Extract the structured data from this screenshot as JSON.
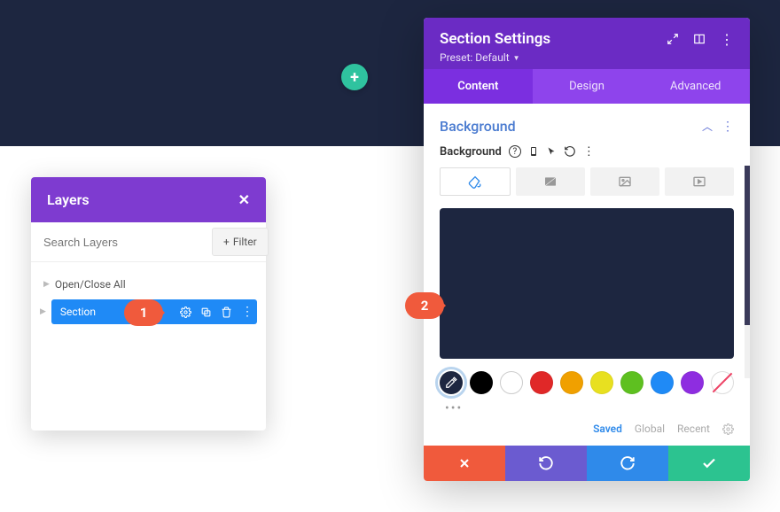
{
  "add_button_glyph": "+",
  "layers": {
    "title": "Layers",
    "close_glyph": "✕",
    "search_placeholder": "Search Layers",
    "filter_label": "Filter",
    "open_close_all": "Open/Close All",
    "section_label": "Section"
  },
  "settings": {
    "title": "Section Settings",
    "preset_label": "Preset: Default",
    "tabs": {
      "content": "Content",
      "design": "Design",
      "advanced": "Advanced"
    },
    "section_heading": "Background",
    "bg_label": "Background",
    "preview_color": "#1d2640",
    "swatch_colors": [
      "#000000",
      "#ffffff",
      "#e02828",
      "#f0a000",
      "#e8e020",
      "#5ec020",
      "#1f8af6",
      "#8e2de0"
    ],
    "more_glyph": "•••",
    "filters": {
      "saved": "Saved",
      "global": "Global",
      "recent": "Recent"
    },
    "footer_colors": {
      "cancel": "#f05a3c",
      "undo": "#6b5bd0",
      "redo": "#2f8aea",
      "save": "#2cc390"
    }
  },
  "callouts": {
    "one": "1",
    "two": "2"
  }
}
